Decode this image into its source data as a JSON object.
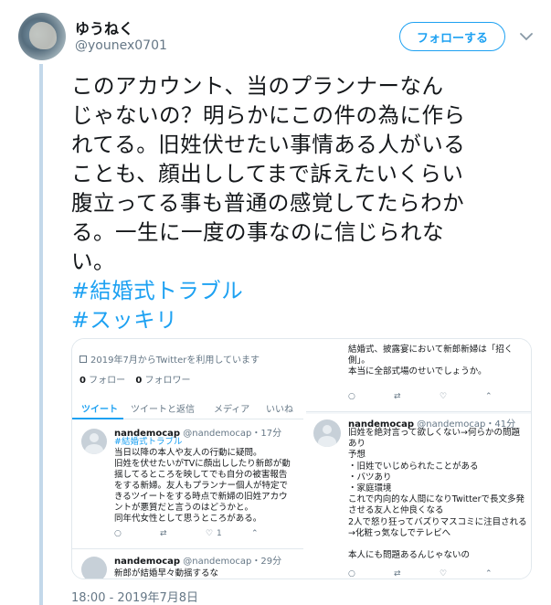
{
  "author": {
    "name": "ゆうねく",
    "handle": "@younex0701",
    "follow_label": "フォローする",
    "avatar_icon": "avatar-image",
    "menu_icon": "chevron-down-icon"
  },
  "tweet": {
    "lines": [
      "このアカウント、当のプランナーなん",
      "じゃないの？明らかにこの件の為に作ら",
      "れてる。旧姓伏せたい事情ある人がいる",
      "ことも、顔出ししてまで訴えたいくらい",
      "腹立ってる事も普通の感覚してたらわか",
      "る。一生に一度の事なのに信じられな",
      "い。"
    ],
    "hashtags": [
      "#結婚式トラブル",
      "#スッキリ"
    ],
    "timestamp": "18:00 - 2019年7月8日"
  },
  "left_screenshot": {
    "joined": "2019年7月からTwitterを利用しています",
    "following": "0",
    "following_label": "フォロー",
    "followers": "0",
    "followers_label": "フォロワー",
    "tabs": [
      "ツイート",
      "ツイートと返信",
      "メディア",
      "いいね"
    ],
    "tweet1": {
      "name": "nandemocap",
      "meta": "@nandemocap・17分",
      "hashtag": "#結婚式トラブル",
      "lines": [
        "当日以降の本人や友人の行動に疑問。",
        "旧姓を伏せたいがTVに顔出ししたり新郎が動",
        "揺してるところを映してでも自分の被害報告",
        "をする新婦。友人もプランナー個人が特定で",
        "きるツイートをする時点で新婦の旧姓アカウ",
        "ントが悪質だと言うのはどうかと。",
        "同年代女性として思うところがある。"
      ],
      "like_count": "1"
    },
    "tweet2": {
      "name": "nandemocap",
      "meta": "@nandemocap・29分",
      "lines": [
        "新郎が結婚早々動揺するな"
      ]
    }
  },
  "right_screenshot": {
    "top_lines": [
      "結婚式、披露宴において新郎新婦は「招く",
      "側」。",
      "本当に全部式場のせいでしょうか。"
    ],
    "tweet": {
      "name": "nandemocap",
      "meta": "@nandemocap・41分",
      "lines": [
        "旧姓を絶対言って欲しくない→何らかの問題",
        "あり",
        "予想",
        "・旧姓でいじめられたことがある",
        "・バツあり",
        "・家庭環境",
        "これで内向的な人間になりTwitterで長文多発",
        "させる友人と仲良くなる",
        "2人で怒り狂ってバズりマスコミに注目される",
        "→化粧っ気なしでテレビへ",
        "",
        "本人にも問題あるんじゃないの"
      ]
    }
  },
  "colors": {
    "accent": "#1da1f2",
    "text": "#14171a",
    "muted": "#657786",
    "thread_line": "#c3d8ea"
  }
}
